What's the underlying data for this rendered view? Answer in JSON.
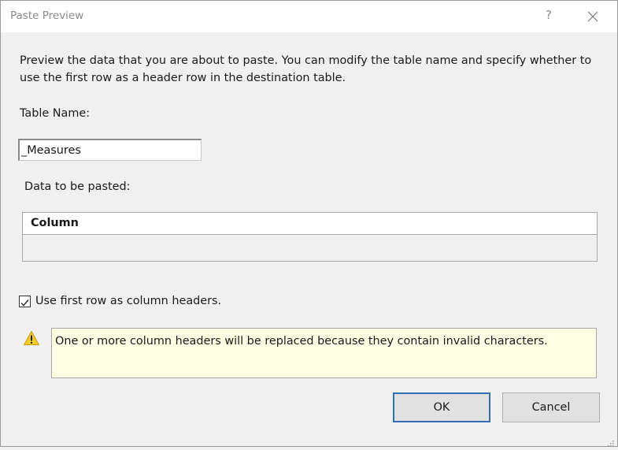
{
  "window": {
    "title": "Paste Preview",
    "help_label": "?",
    "close_icon": "close-icon"
  },
  "description": "Preview the data that you are about to paste. You can modify the table name and specify whether to use the first row as a header row in the destination table.",
  "table_name": {
    "label": "Table Name:",
    "value": "_Measures"
  },
  "data_preview": {
    "label": "Data to be pasted:",
    "columns": [
      "Column"
    ],
    "rows": []
  },
  "header_option": {
    "label": "Use first row as column headers.",
    "checked": true
  },
  "warning": {
    "icon": "warning-icon",
    "message": "One or more column headers will be replaced because they contain invalid characters."
  },
  "buttons": {
    "ok_label": "OK",
    "cancel_label": "Cancel"
  }
}
